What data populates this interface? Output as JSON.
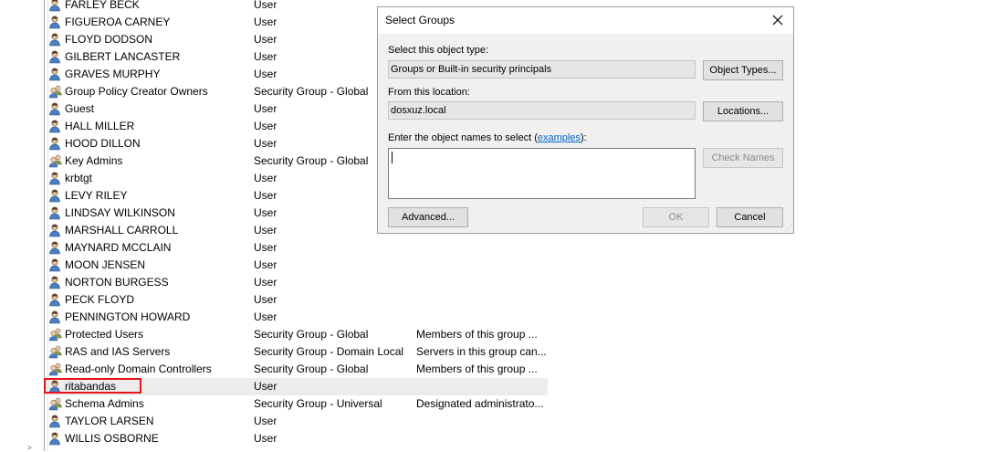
{
  "list": {
    "rows": [
      {
        "name": "FARLEY BECK",
        "type": "User",
        "desc": "",
        "icon": "user-icon"
      },
      {
        "name": "FIGUEROA CARNEY",
        "type": "User",
        "desc": "",
        "icon": "user-icon"
      },
      {
        "name": "FLOYD DODSON",
        "type": "User",
        "desc": "",
        "icon": "user-icon"
      },
      {
        "name": "GILBERT LANCASTER",
        "type": "User",
        "desc": "",
        "icon": "user-icon"
      },
      {
        "name": "GRAVES MURPHY",
        "type": "User",
        "desc": "",
        "icon": "user-icon"
      },
      {
        "name": "Group Policy Creator Owners",
        "type": "Security Group - Global",
        "desc": "",
        "icon": "group-icon"
      },
      {
        "name": "Guest",
        "type": "User",
        "desc": "",
        "icon": "user-icon"
      },
      {
        "name": "HALL MILLER",
        "type": "User",
        "desc": "",
        "icon": "user-icon"
      },
      {
        "name": "HOOD DILLON",
        "type": "User",
        "desc": "",
        "icon": "user-icon"
      },
      {
        "name": "Key Admins",
        "type": "Security Group - Global",
        "desc": "",
        "icon": "group-icon"
      },
      {
        "name": "krbtgt",
        "type": "User",
        "desc": "",
        "icon": "user-icon"
      },
      {
        "name": "LEVY RILEY",
        "type": "User",
        "desc": "",
        "icon": "user-icon"
      },
      {
        "name": "LINDSAY WILKINSON",
        "type": "User",
        "desc": "",
        "icon": "user-icon"
      },
      {
        "name": "MARSHALL CARROLL",
        "type": "User",
        "desc": "",
        "icon": "user-icon"
      },
      {
        "name": "MAYNARD MCCLAIN",
        "type": "User",
        "desc": "",
        "icon": "user-icon"
      },
      {
        "name": "MOON JENSEN",
        "type": "User",
        "desc": "",
        "icon": "user-icon"
      },
      {
        "name": "NORTON BURGESS",
        "type": "User",
        "desc": "",
        "icon": "user-icon"
      },
      {
        "name": "PECK FLOYD",
        "type": "User",
        "desc": "",
        "icon": "user-icon"
      },
      {
        "name": "PENNINGTON HOWARD",
        "type": "User",
        "desc": "",
        "icon": "user-icon"
      },
      {
        "name": "Protected Users",
        "type": "Security Group - Global",
        "desc": "Members of this group ...",
        "icon": "group-icon"
      },
      {
        "name": "RAS and IAS Servers",
        "type": "Security Group - Domain Local",
        "desc": "Servers in this group can...",
        "icon": "group-icon"
      },
      {
        "name": "Read-only Domain Controllers",
        "type": "Security Group - Global",
        "desc": "Members of this group ...",
        "icon": "group-icon"
      },
      {
        "name": "ritabandas",
        "type": "User",
        "desc": "",
        "icon": "user-icon",
        "selected": true
      },
      {
        "name": "Schema Admins",
        "type": "Security Group - Universal",
        "desc": "Designated administrato...",
        "icon": "group-icon"
      },
      {
        "name": "TAYLOR LARSEN",
        "type": "User",
        "desc": "",
        "icon": "user-icon"
      },
      {
        "name": "WILLIS OSBORNE",
        "type": "User",
        "desc": "",
        "icon": "user-icon"
      }
    ]
  },
  "dialog": {
    "title": "Select Groups",
    "object_type_label": "Select this object type:",
    "object_type_value": "Groups or Built-in security principals",
    "object_types_button": "Object Types...",
    "location_label": "From this location:",
    "location_value": "dosxuz.local",
    "locations_button": "Locations...",
    "names_label_prefix": "Enter the object names to select (",
    "names_label_link": "examples",
    "names_label_suffix": "):",
    "names_value": "",
    "check_names_button": "Check Names",
    "advanced_button": "Advanced...",
    "ok_button": "OK",
    "cancel_button": "Cancel"
  },
  "colors": {
    "highlight_border": "#e8141c",
    "link": "#0066cc",
    "user_icon_blue": "#4a7fc1",
    "group_icon_secondary": "#8a9a5b"
  }
}
